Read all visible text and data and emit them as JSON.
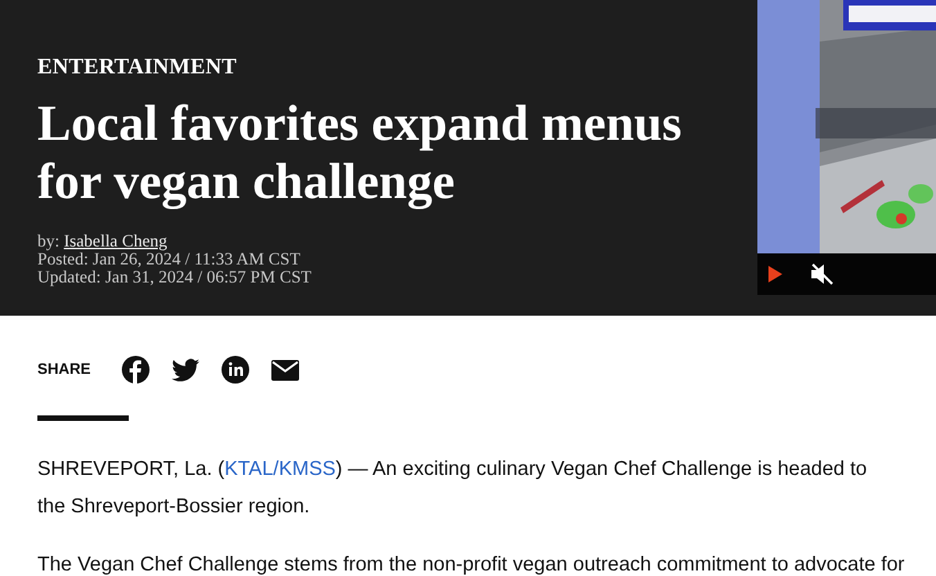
{
  "category": "ENTERTAINMENT",
  "headline": "Local favorites expand menus for vegan challenge",
  "byline": {
    "prefix": "by:",
    "author": "Isabella Cheng"
  },
  "posted": "Posted: Jan 26, 2024 / 11:33 AM CST",
  "updated": "Updated: Jan 31, 2024 / 06:57 PM CST",
  "video": {
    "kind": "picture",
    "playing": false,
    "muted": true
  },
  "share": {
    "label": "SHARE",
    "icons": [
      {
        "kind": "facebook"
      },
      {
        "kind": "twitter"
      },
      {
        "kind": "linkedin"
      },
      {
        "kind": "email"
      }
    ]
  },
  "paragraphs": [
    {
      "before": "SHREVEPORT, La. (",
      "link": "KTAL/KMSS",
      "after": ") — An exciting culinary Vegan Chef Challenge is headed to the Shreveport-Bossier region."
    },
    {
      "before": "The Vegan Chef Challenge stems from the non-profit vegan outreach commitment to advocate for"
    }
  ]
}
